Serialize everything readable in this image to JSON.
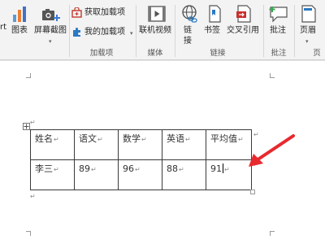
{
  "ribbon": {
    "left_partial": "rt",
    "chart": "图表",
    "screenshot": "屏幕截图",
    "get_addins": "获取加载项",
    "my_addins": "我的加载项",
    "addins_group": "加载项",
    "online_video": "联机视频",
    "media_group": "媒体",
    "link_line1": "链",
    "link_line2": "接",
    "bookmark": "书签",
    "cross_ref": "交叉引用",
    "links_group": "链接",
    "comment": "批注",
    "comment_group": "批注",
    "header": "页眉",
    "header_group_partial": "页"
  },
  "table": {
    "headers": [
      "姓名",
      "语文",
      "数学",
      "英语",
      "平均值"
    ],
    "row": [
      "李三",
      "89",
      "96",
      "88",
      "91"
    ]
  },
  "marks": {
    "cell_end": "↵",
    "para": "↵"
  },
  "colors": {
    "ribbon_bg": "#f3f3f3",
    "arrow": "#e8292f",
    "table_border": "#3a3a3a"
  },
  "icons": [
    "chart-icon",
    "screenshot-icon",
    "store-icon",
    "addin-icon",
    "video-icon",
    "link-icon",
    "bookmark-icon",
    "cross-reference-icon",
    "comment-icon",
    "header-icon",
    "table-move-handle",
    "red-arrow"
  ]
}
